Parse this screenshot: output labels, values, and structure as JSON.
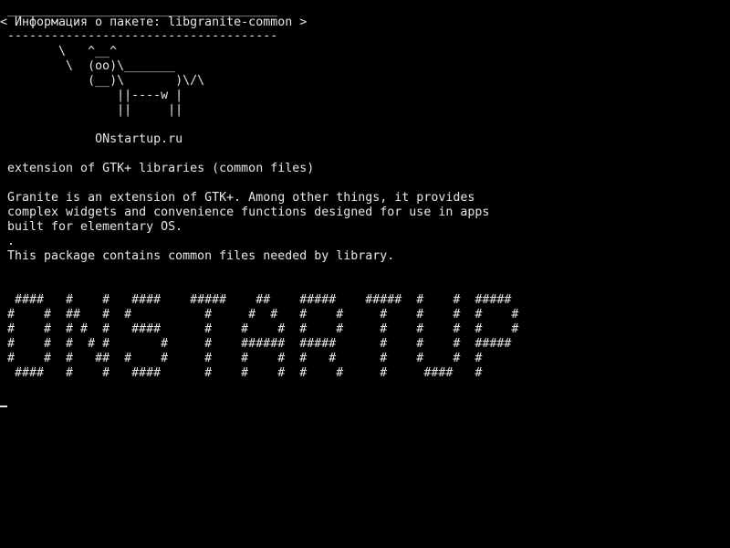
{
  "terminal": {
    "bubble": {
      "top_border": " _____________________________________",
      "text": "< Информация о пакете: libgranite-common >",
      "bottom_border": " -------------------------------------"
    },
    "cow": [
      "        \\   ^__^",
      "         \\  (oo)\\_______",
      "            (__)\\       )\\/\\",
      "                ||----w |",
      "                ||     ||"
    ],
    "site": "             ONstartup.ru",
    "summary": " extension of GTK+ libraries (common files)",
    "description": [
      " Granite is an extension of GTK+. Among other things, it provides",
      " complex widgets and convenience functions designed for use in apps",
      " built for elementary OS.",
      " .",
      " This package contains common files needed by library."
    ],
    "banner": [
      "  ####   #    #   ####    #####    ##    #####    #####  #    #  #####",
      " #    #  ##   #  #          #     #  #   #    #     #    #    #  #    #",
      " #    #  # #  #   ####      #    #    #  #    #     #    #    #  #    #",
      " #    #  #  # #       #     #    ######  #####      #    #    #  #####",
      " #    #  #   ##  #    #     #    #    #  #   #      #    #    #  #",
      "  ####   #    #   ####      #    #    #  #    #     #     ####   #"
    ]
  }
}
